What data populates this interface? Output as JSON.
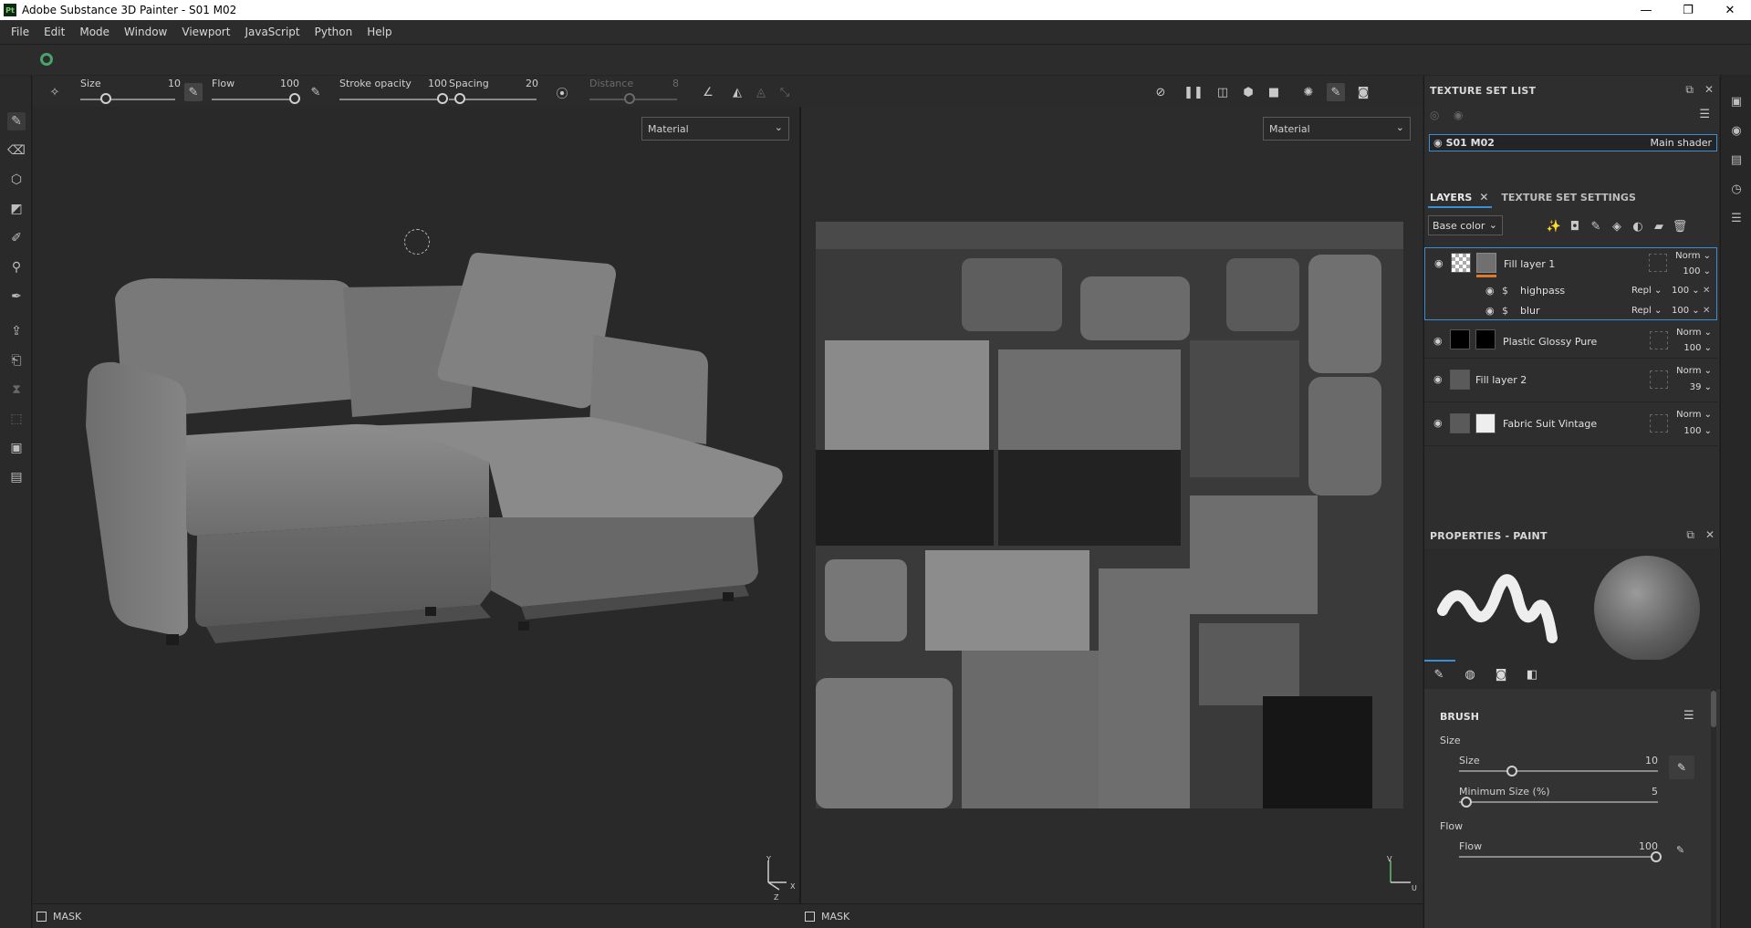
{
  "window": {
    "app_icon": "Pt",
    "title": "Adobe Substance 3D Painter - S01 M02",
    "controls": [
      "—",
      "❐",
      "✕"
    ]
  },
  "menu": [
    "File",
    "Edit",
    "Mode",
    "Window",
    "Viewport",
    "JavaScript",
    "Python",
    "Help"
  ],
  "toolbar": {
    "size_label": "Size",
    "size_value": "10",
    "flow_label": "Flow",
    "flow_value": "100",
    "stroke_opacity_label": "Stroke opacity",
    "stroke_opacity_value": "100",
    "spacing_label": "Spacing",
    "spacing_value": "20",
    "distance_label": "Distance",
    "distance_value": "8"
  },
  "viewport_left": {
    "mode": "Material",
    "mask_label": "MASK",
    "axis_y": "Y",
    "axis_x": "X",
    "axis_z": "Z"
  },
  "viewport_right": {
    "mode": "Material",
    "mask_label": "MASK",
    "axis_v": "V",
    "axis_u": "U"
  },
  "texture_set_list": {
    "title": "TEXTURE SET LIST",
    "items": [
      {
        "name": "S01 M02",
        "shader": "Main shader"
      }
    ]
  },
  "layers_panel": {
    "tab_layers": "LAYERS",
    "tab_close": "✕",
    "tab_texture_set_settings": "TEXTURE SET SETTINGS",
    "channel": "Base color",
    "layers": [
      {
        "name": "Fill layer 1",
        "blend": "Norm",
        "opacity": "100",
        "effects": [
          {
            "name": "highpass",
            "blend": "Repl",
            "opacity": "100"
          },
          {
            "name": "blur",
            "blend": "Repl",
            "opacity": "100"
          }
        ]
      },
      {
        "name": "Plastic Glossy Pure",
        "blend": "Norm",
        "opacity": "100"
      },
      {
        "name": "Fill layer 2",
        "blend": "Norm",
        "opacity": "39"
      },
      {
        "name": "Fabric Suit Vintage",
        "blend": "Norm",
        "opacity": "100"
      }
    ]
  },
  "properties": {
    "title": "PROPERTIES - PAINT",
    "section_brush": "BRUSH",
    "group_size": "Size",
    "size_label": "Size",
    "size_value": "10",
    "min_size_label": "Minimum Size (%)",
    "min_size_value": "5",
    "group_flow": "Flow",
    "flow_label": "Flow",
    "flow_value": "100"
  },
  "colors": {
    "accent_blue": "#3b8fd6",
    "accent_orange": "#e07a2a",
    "brand_green": "#49a36a",
    "panel_bg": "#2e2e2e",
    "viewport_bg": "#292929"
  }
}
